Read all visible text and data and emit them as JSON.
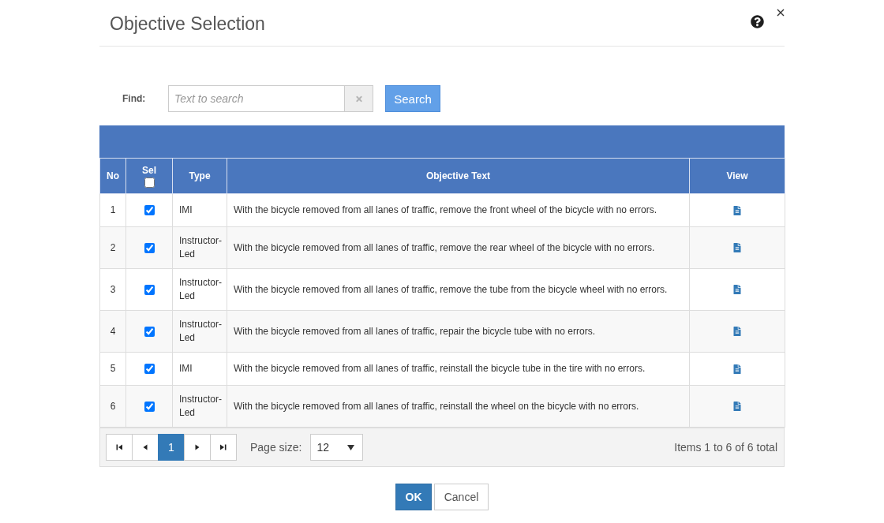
{
  "dialog": {
    "title": "Objective Selection"
  },
  "search": {
    "label": "Find:",
    "placeholder": "Text to search",
    "button": "Search"
  },
  "table": {
    "columns": [
      "No",
      "Sel",
      "Type",
      "Objective Text",
      "View"
    ],
    "select_all_checked": false,
    "rows": [
      {
        "no": "1",
        "checked": true,
        "type": "IMI",
        "objective_text": "With the bicycle removed from all lanes of traffic, remove the front wheel of the bicycle with no errors."
      },
      {
        "no": "2",
        "checked": true,
        "type": "Instructor-Led",
        "objective_text": "With the bicycle removed from all lanes of traffic, remove the rear wheel of the bicycle with no errors."
      },
      {
        "no": "3",
        "checked": true,
        "type": "Instructor-Led",
        "objective_text": "With the bicycle removed from all lanes of traffic, remove the tube from the bicycle wheel with no errors."
      },
      {
        "no": "4",
        "checked": true,
        "type": "Instructor-Led",
        "objective_text": "With the bicycle removed from all lanes of traffic, repair the bicycle tube with no errors."
      },
      {
        "no": "5",
        "checked": true,
        "type": "IMI",
        "objective_text": "With the bicycle removed from all lanes of traffic, reinstall the bicycle tube in the tire with no errors."
      },
      {
        "no": "6",
        "checked": true,
        "type": "Instructor-Led",
        "objective_text": "With the bicycle removed from all lanes of traffic, reinstall the wheel on the bicycle with no errors."
      }
    ]
  },
  "pager": {
    "pages": [
      {
        "label": "1",
        "selected": true
      }
    ],
    "page_size_label": "Page size:",
    "page_size": "12",
    "summary": "Items 1 to 6 of 6 total"
  },
  "buttons": [
    {
      "label": "OK",
      "kind": "primary"
    },
    {
      "label": "Cancel",
      "kind": "default"
    }
  ]
}
